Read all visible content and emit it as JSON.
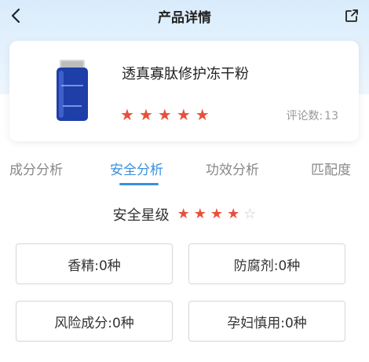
{
  "header": {
    "title": "产品详情"
  },
  "product": {
    "name": "透真寡肽修护冻干粉",
    "rating": 5,
    "review_label": "评论数:",
    "review_count": "13"
  },
  "tabs": [
    {
      "label": "成分分析",
      "active": false
    },
    {
      "label": "安全分析",
      "active": true
    },
    {
      "label": "功效分析",
      "active": false
    },
    {
      "label": "匹配度",
      "active": false
    }
  ],
  "safety": {
    "label": "安全星级",
    "rating": 4,
    "max": 5
  },
  "stats": [
    {
      "text": "香精:0种"
    },
    {
      "text": "防腐剂:0种"
    },
    {
      "text": "风险成分:0种"
    },
    {
      "text": "孕妇慎用:0种"
    }
  ],
  "colors": {
    "accent": "#3a8fe0",
    "star_filled": "#e8503a",
    "star_empty": "#c8c8c8"
  },
  "icons": {
    "back": "chevron-left-icon",
    "share": "share-icon"
  }
}
